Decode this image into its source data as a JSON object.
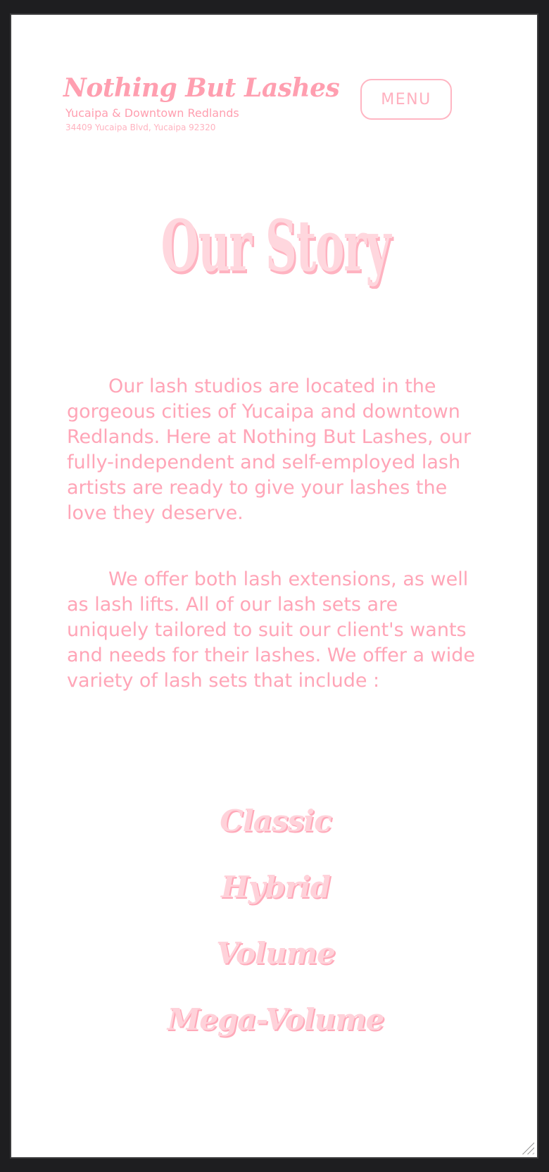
{
  "header": {
    "brand_title": "Nothing But Lashes",
    "brand_subtitle": "Yucaipa & Downtown Redlands",
    "brand_address": "34409 Yucaipa Blvd, Yucaipa 92320",
    "menu_label": "MENU"
  },
  "main": {
    "title": "Our Story",
    "paragraphs": [
      "Our lash studios are located in the gorgeous cities of Yucaipa and downtown Redlands. Here at Nothing But Lashes, our fully-independent and self-employed lash artists are ready to give your lashes the love they deserve.",
      "We offer both lash extensions, as well as lash lifts. All of our lash sets are uniquely tailored to suit our client's wants and needs for their lashes. We offer a wide variety of lash sets that include :"
    ],
    "lash_sets": [
      "Classic",
      "Hybrid",
      "Volume",
      "Mega-Volume"
    ]
  },
  "colors": {
    "accent": "#ffa5b7",
    "title_fill": "#ffd7de",
    "frame_border": "#3a3a3c",
    "background": "#ffffff"
  }
}
